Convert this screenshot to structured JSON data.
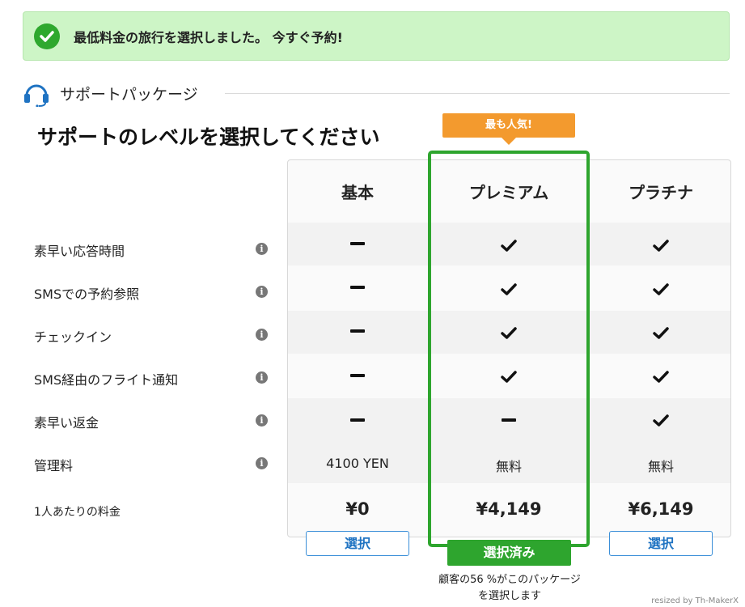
{
  "banner": {
    "message": "最低料金の旅行を選択しました。 今すぐ予約!",
    "icon": "check-circle-icon",
    "color": "#2ea82e"
  },
  "section": {
    "title": "サポートパッケージ",
    "icon": "headset-icon"
  },
  "question": "サポートのレベルを選択してください",
  "badge": "最も人気!",
  "columns": [
    "基本",
    "プレミアム",
    "プラチナ"
  ],
  "features": [
    {
      "label": "素早い応答時間",
      "values": [
        "dash",
        "check",
        "check"
      ]
    },
    {
      "label": "SMSでの予約参照",
      "values": [
        "dash",
        "check",
        "check"
      ]
    },
    {
      "label": "チェックイン",
      "values": [
        "dash",
        "check",
        "check"
      ]
    },
    {
      "label": "SMS経由のフライト通知",
      "values": [
        "dash",
        "check",
        "check"
      ]
    },
    {
      "label": "素早い返金",
      "values": [
        "dash",
        "dash",
        "check"
      ]
    }
  ],
  "fee": {
    "label": "管理料",
    "values": [
      "4100 YEN",
      "無料",
      "無料"
    ]
  },
  "price": {
    "label": "1人あたりの料金",
    "values": [
      "¥0",
      "¥4,149",
      "¥6,149"
    ]
  },
  "buttons": {
    "select": "選択",
    "selected": "選択済み"
  },
  "note_line1": "顧客の56 %がこのパッケージ",
  "note_line2": "を選択します",
  "credit": "resized by Th-MakerX",
  "colors": {
    "accent_green": "#2ea52e",
    "badge_orange": "#f39a2e",
    "link_blue": "#1f73c2",
    "banner_bg": "#cdf5c6"
  }
}
